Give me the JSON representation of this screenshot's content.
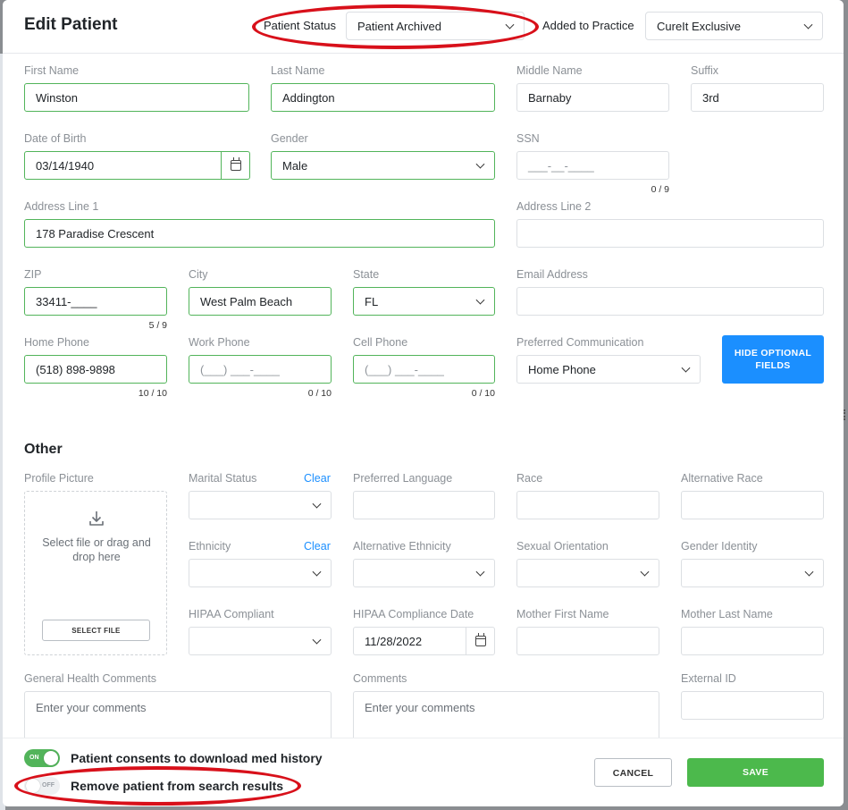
{
  "header": {
    "title": "Edit Patient",
    "patient_status_label": "Patient Status",
    "patient_status_value": "Patient Archived",
    "added_label": "Added to Practice",
    "added_value": "CureIt Exclusive"
  },
  "fields": {
    "first_name": {
      "label": "First Name",
      "value": "Winston"
    },
    "last_name": {
      "label": "Last Name",
      "value": "Addington"
    },
    "middle_name": {
      "label": "Middle Name",
      "value": "Barnaby"
    },
    "suffix": {
      "label": "Suffix",
      "value": "3rd"
    },
    "dob": {
      "label": "Date of Birth",
      "value": "03/14/1940"
    },
    "gender": {
      "label": "Gender",
      "value": "Male"
    },
    "ssn": {
      "label": "SSN",
      "placeholder": "___-__-____",
      "counter": "0 / 9"
    },
    "address1": {
      "label": "Address Line 1",
      "value": "178 Paradise Crescent"
    },
    "address2": {
      "label": "Address Line 2",
      "value": ""
    },
    "zip": {
      "label": "ZIP",
      "value": "33411-____",
      "counter": "5 / 9"
    },
    "city": {
      "label": "City",
      "value": "West Palm Beach"
    },
    "state": {
      "label": "State",
      "value": "FL"
    },
    "email": {
      "label": "Email Address",
      "value": ""
    },
    "home_phone": {
      "label": "Home Phone",
      "value": "(518) 898-9898",
      "counter": "10 / 10"
    },
    "work_phone": {
      "label": "Work Phone",
      "placeholder": "(___) ___-____",
      "counter": "0 / 10"
    },
    "cell_phone": {
      "label": "Cell Phone",
      "placeholder": "(___) ___-____",
      "counter": "0 / 10"
    },
    "pref_comm": {
      "label": "Preferred Communication",
      "value": "Home Phone"
    },
    "hide_optional": "HIDE OPTIONAL FIELDS"
  },
  "other": {
    "title": "Other",
    "profile_picture_label": "Profile Picture",
    "upload_text": "Select file or drag and drop here",
    "select_file": "SELECT FILE",
    "marital_status": "Marital Status",
    "clear": "Clear",
    "preferred_language": "Preferred Language",
    "race": "Race",
    "alternative_race": "Alternative Race",
    "ethnicity": "Ethnicity",
    "alternative_ethnicity": "Alternative Ethnicity",
    "sexual_orientation": "Sexual Orientation",
    "gender_identity": "Gender Identity",
    "hipaa_compliant": "HIPAA Compliant",
    "hipaa_date_label": "HIPAA Compliance Date",
    "hipaa_date_value": "11/28/2022",
    "mother_first": "Mother First Name",
    "mother_last": "Mother Last Name",
    "general_comments_label": "General Health Comments",
    "comments_label": "Comments",
    "comments_placeholder": "Enter your comments",
    "external_id": "External ID"
  },
  "footer": {
    "consent_label": "Patient consents to download med history",
    "consent_state": "ON",
    "remove_label": "Remove patient from search results",
    "remove_state": "OFF",
    "cancel": "CANCEL",
    "save": "SAVE"
  },
  "colors": {
    "accent_green": "#52b45a",
    "accent_blue": "#1b8fff",
    "annotation_red": "#d8101a"
  }
}
